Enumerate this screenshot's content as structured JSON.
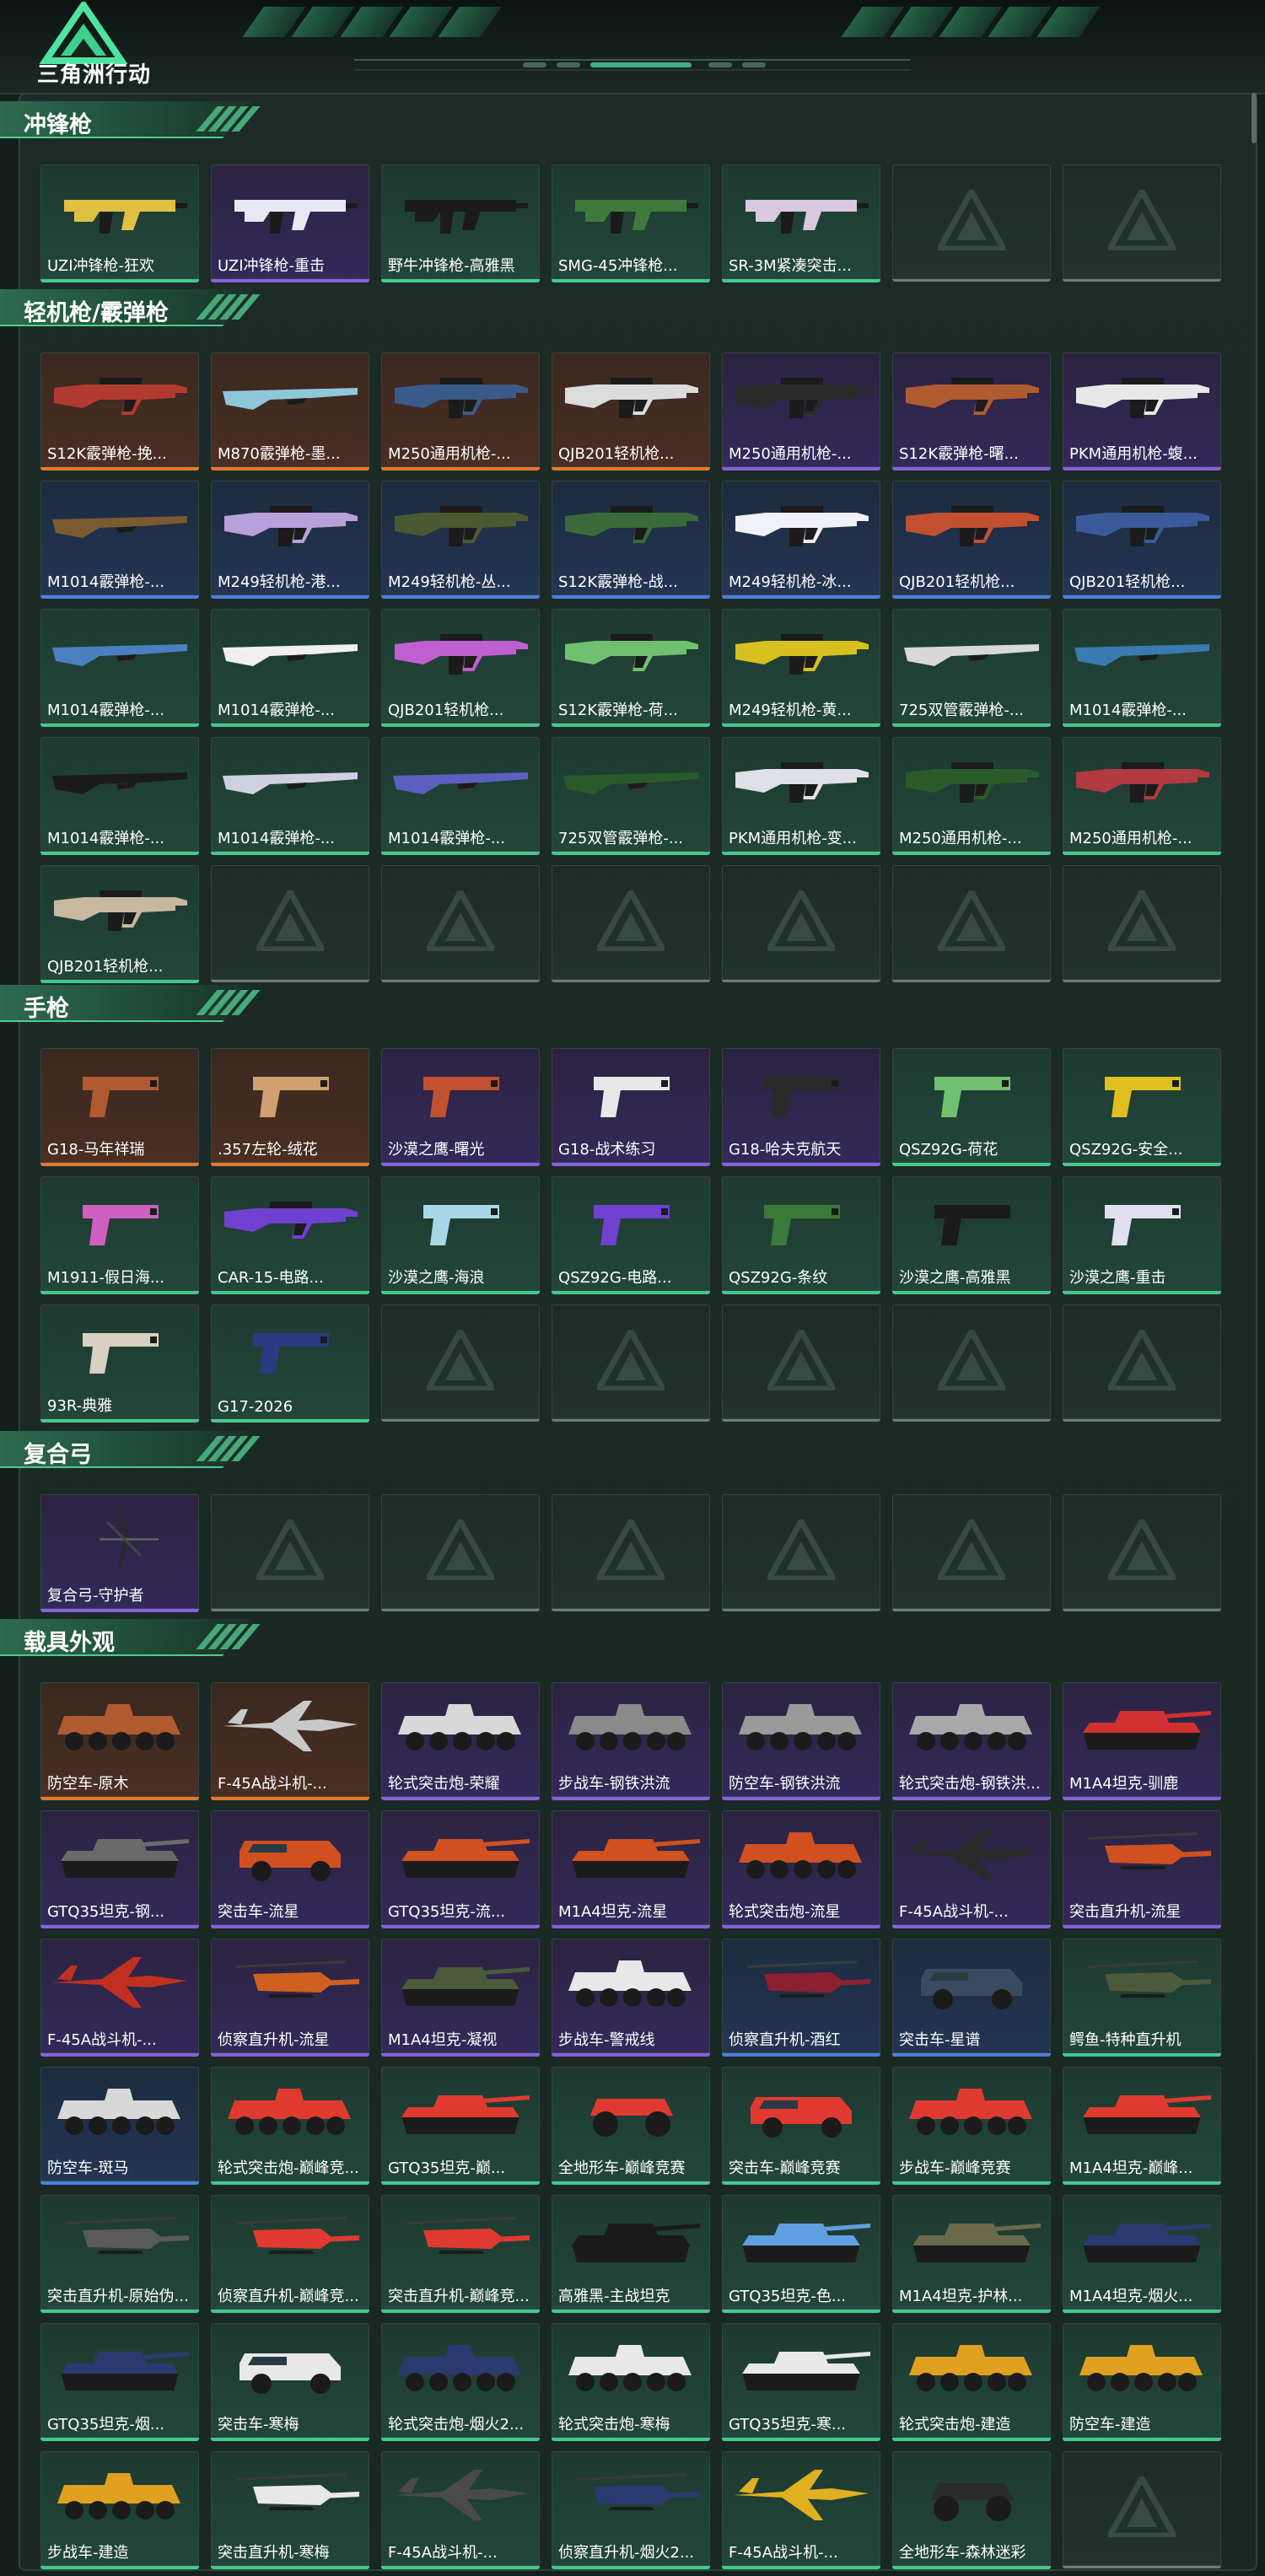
{
  "header": {
    "logo_text": "三角洲行动"
  },
  "colors": {
    "green": "#43c98f",
    "blue": "#4b7fe0",
    "purple": "#8a5ee0",
    "orange": "#e6772f",
    "empty": "#707a76"
  },
  "sections": [
    {
      "title": "冲锋枪",
      "items": [
        {
          "label": "UZI冲锋枪-狂欢",
          "rarity": "green",
          "kind": "smg",
          "c": "#e0c040"
        },
        {
          "label": "UZI冲锋枪-重击",
          "rarity": "purple",
          "kind": "smg",
          "c": "#e8e8f4"
        },
        {
          "label": "野牛冲锋枪-高雅黑",
          "rarity": "green",
          "kind": "smg",
          "c": "#1a1a1a"
        },
        {
          "label": "SMG-45冲锋枪...",
          "rarity": "green",
          "kind": "smg",
          "c": "#3f7a3d"
        },
        {
          "label": "SR-3M紧凑突击...",
          "rarity": "green",
          "kind": "smg",
          "c": "#d8c8e0"
        },
        {
          "label": "",
          "rarity": "empty",
          "kind": "empty"
        },
        {
          "label": "",
          "rarity": "empty",
          "kind": "empty"
        }
      ]
    },
    {
      "title": "轻机枪/霰弹枪",
      "items": [
        {
          "label": "S12K霰弹枪-挽...",
          "rarity": "orange",
          "kind": "rifle",
          "c": "#b03a30"
        },
        {
          "label": "M870霰弹枪-墨...",
          "rarity": "orange",
          "kind": "shotgun",
          "c": "#8ec8d8"
        },
        {
          "label": "M250通用机枪-...",
          "rarity": "orange",
          "kind": "lmg",
          "c": "#3a5a8a"
        },
        {
          "label": "QJB201轻机枪...",
          "rarity": "orange",
          "kind": "lmg",
          "c": "#dcdcdc"
        },
        {
          "label": "M250通用机枪-...",
          "rarity": "purple",
          "kind": "lmg",
          "c": "#2a2a2a"
        },
        {
          "label": "S12K霰弹枪-曙...",
          "rarity": "purple",
          "kind": "rifle",
          "c": "#b05a30"
        },
        {
          "label": "PKM通用机枪-蝮...",
          "rarity": "purple",
          "kind": "lmg",
          "c": "#e8e8e8"
        },
        {
          "label": "M1014霰弹枪-...",
          "rarity": "blue",
          "kind": "shotgun",
          "c": "#7a5a30"
        },
        {
          "label": "M249轻机枪-港...",
          "rarity": "blue",
          "kind": "lmg",
          "c": "#b8a0d8"
        },
        {
          "label": "M249轻机枪-丛...",
          "rarity": "blue",
          "kind": "lmg",
          "c": "#4a5a30"
        },
        {
          "label": "S12K霰弹枪-战...",
          "rarity": "blue",
          "kind": "rifle",
          "c": "#3a6a3a"
        },
        {
          "label": "M249轻机枪-冰...",
          "rarity": "blue",
          "kind": "lmg",
          "c": "#f0f0f8"
        },
        {
          "label": "QJB201轻机枪...",
          "rarity": "blue",
          "kind": "lmg",
          "c": "#c05030"
        },
        {
          "label": "QJB201轻机枪...",
          "rarity": "blue",
          "kind": "lmg",
          "c": "#3a5a9a"
        },
        {
          "label": "M1014霰弹枪-...",
          "rarity": "green",
          "kind": "shotgun",
          "c": "#4a80c0"
        },
        {
          "label": "M1014霰弹枪-...",
          "rarity": "green",
          "kind": "shotgun",
          "c": "#f0f0f0"
        },
        {
          "label": "QJB201轻机枪...",
          "rarity": "green",
          "kind": "lmg",
          "c": "#c060d0"
        },
        {
          "label": "S12K霰弹枪-荷...",
          "rarity": "green",
          "kind": "rifle",
          "c": "#70c070"
        },
        {
          "label": "M249轻机枪-黄...",
          "rarity": "green",
          "kind": "lmg",
          "c": "#d8c020"
        },
        {
          "label": "725双管霰弹枪-...",
          "rarity": "green",
          "kind": "shotgun",
          "c": "#d8d8d8"
        },
        {
          "label": "M1014霰弹枪-...",
          "rarity": "green",
          "kind": "shotgun",
          "c": "#3a7ab0"
        },
        {
          "label": "M1014霰弹枪-...",
          "rarity": "green",
          "kind": "shotgun",
          "c": "#1a1a1a"
        },
        {
          "label": "M1014霰弹枪-...",
          "rarity": "green",
          "kind": "shotgun",
          "c": "#d0d0e0"
        },
        {
          "label": "M1014霰弹枪-...",
          "rarity": "green",
          "kind": "shotgun",
          "c": "#5a60c0"
        },
        {
          "label": "725双管霰弹枪-...",
          "rarity": "green",
          "kind": "shotgun",
          "c": "#2a5a2a"
        },
        {
          "label": "PKM通用机枪-变...",
          "rarity": "green",
          "kind": "lmg",
          "c": "#e0e0e8"
        },
        {
          "label": "M250通用机枪-...",
          "rarity": "green",
          "kind": "lmg",
          "c": "#2a5a2a"
        },
        {
          "label": "M250通用机枪-...",
          "rarity": "green",
          "kind": "lmg",
          "c": "#b03a40"
        },
        {
          "label": "QJB201轻机枪...",
          "rarity": "green",
          "kind": "lmg",
          "c": "#c8b8a0"
        },
        {
          "label": "",
          "rarity": "empty",
          "kind": "empty"
        },
        {
          "label": "",
          "rarity": "empty",
          "kind": "empty"
        },
        {
          "label": "",
          "rarity": "empty",
          "kind": "empty"
        },
        {
          "label": "",
          "rarity": "empty",
          "kind": "empty"
        },
        {
          "label": "",
          "rarity": "empty",
          "kind": "empty"
        },
        {
          "label": "",
          "rarity": "empty",
          "kind": "empty"
        }
      ]
    },
    {
      "title": "手枪",
      "items": [
        {
          "label": "G18-马年祥瑞",
          "rarity": "orange",
          "kind": "pistol",
          "c": "#b05a30"
        },
        {
          "label": ".357左轮-绒花",
          "rarity": "orange",
          "kind": "pistol",
          "c": "#d0a070"
        },
        {
          "label": "沙漠之鹰-曙光",
          "rarity": "purple",
          "kind": "pistol",
          "c": "#c05030"
        },
        {
          "label": "G18-战术练习",
          "rarity": "purple",
          "kind": "pistol",
          "c": "#e8e8e8"
        },
        {
          "label": "G18-哈夫克航天",
          "rarity": "purple",
          "kind": "pistol",
          "c": "#2a2a2a"
        },
        {
          "label": "QSZ92G-荷花",
          "rarity": "green",
          "kind": "pistol",
          "c": "#70c070"
        },
        {
          "label": "QSZ92G-安全...",
          "rarity": "green",
          "kind": "pistol",
          "c": "#e0c020"
        },
        {
          "label": "M1911-假日海...",
          "rarity": "green",
          "kind": "pistol",
          "c": "#d060c0"
        },
        {
          "label": "CAR-15-电路...",
          "rarity": "green",
          "kind": "rifle",
          "c": "#7040d0"
        },
        {
          "label": "沙漠之鹰-海浪",
          "rarity": "green",
          "kind": "pistol",
          "c": "#a8d8e8"
        },
        {
          "label": "QSZ92G-电路...",
          "rarity": "green",
          "kind": "pistol",
          "c": "#7040d0"
        },
        {
          "label": "QSZ92G-条纹",
          "rarity": "green",
          "kind": "pistol",
          "c": "#3a7a3a"
        },
        {
          "label": "沙漠之鹰-高雅黑",
          "rarity": "green",
          "kind": "pistol",
          "c": "#1a1a1a"
        },
        {
          "label": "沙漠之鹰-重击",
          "rarity": "green",
          "kind": "pistol",
          "c": "#e0e0f0"
        },
        {
          "label": "93R-典雅",
          "rarity": "green",
          "kind": "pistol",
          "c": "#d8d0c0"
        },
        {
          "label": "G17-2026",
          "rarity": "green",
          "kind": "pistol",
          "c": "#2a3a80"
        },
        {
          "label": "",
          "rarity": "empty",
          "kind": "empty"
        },
        {
          "label": "",
          "rarity": "empty",
          "kind": "empty"
        },
        {
          "label": "",
          "rarity": "empty",
          "kind": "empty"
        },
        {
          "label": "",
          "rarity": "empty",
          "kind": "empty"
        },
        {
          "label": "",
          "rarity": "empty",
          "kind": "empty"
        }
      ]
    },
    {
      "title": "复合弓",
      "items": [
        {
          "label": "复合弓-守护者",
          "rarity": "purple",
          "kind": "bow",
          "c": "#2a2a2a"
        },
        {
          "label": "",
          "rarity": "empty",
          "kind": "empty"
        },
        {
          "label": "",
          "rarity": "empty",
          "kind": "empty"
        },
        {
          "label": "",
          "rarity": "empty",
          "kind": "empty"
        },
        {
          "label": "",
          "rarity": "empty",
          "kind": "empty"
        },
        {
          "label": "",
          "rarity": "empty",
          "kind": "empty"
        },
        {
          "label": "",
          "rarity": "empty",
          "kind": "empty"
        }
      ]
    },
    {
      "title": "载具外观",
      "items": [
        {
          "label": "防空车-原木",
          "rarity": "orange",
          "kind": "apc",
          "c": "#b05a30"
        },
        {
          "label": "F-45A战斗机-...",
          "rarity": "orange",
          "kind": "jet",
          "c": "#c8c8c8"
        },
        {
          "label": "轮式突击炮-荣耀",
          "rarity": "purple",
          "kind": "apc",
          "c": "#d8d8d8"
        },
        {
          "label": "步战车-钢铁洪流",
          "rarity": "purple",
          "kind": "apc",
          "c": "#8a8a8a"
        },
        {
          "label": "防空车-钢铁洪流",
          "rarity": "purple",
          "kind": "apc",
          "c": "#9a9a9a"
        },
        {
          "label": "轮式突击炮-钢铁洪...",
          "rarity": "purple",
          "kind": "apc",
          "c": "#a8a8a8"
        },
        {
          "label": "M1A4坦克-驯鹿",
          "rarity": "purple",
          "kind": "tank",
          "c": "#d03030"
        },
        {
          "label": "GTQ35坦克-钢...",
          "rarity": "purple",
          "kind": "tank",
          "c": "#6a6a6a"
        },
        {
          "label": "突击车-流星",
          "rarity": "purple",
          "kind": "truck",
          "c": "#d05020"
        },
        {
          "label": "GTQ35坦克-流...",
          "rarity": "purple",
          "kind": "tank",
          "c": "#d05020"
        },
        {
          "label": "M1A4坦克-流星",
          "rarity": "purple",
          "kind": "tank",
          "c": "#d05020"
        },
        {
          "label": "轮式突击炮-流星",
          "rarity": "purple",
          "kind": "apc",
          "c": "#d05020"
        },
        {
          "label": "F-45A战斗机-...",
          "rarity": "purple",
          "kind": "jet",
          "c": "#2a2a2a"
        },
        {
          "label": "突击直升机-流星",
          "rarity": "purple",
          "kind": "heli",
          "c": "#d05020"
        },
        {
          "label": "F-45A战斗机-...",
          "rarity": "purple",
          "kind": "jet",
          "c": "#c03020"
        },
        {
          "label": "侦察直升机-流星",
          "rarity": "purple",
          "kind": "heli",
          "c": "#d06020"
        },
        {
          "label": "M1A4坦克-凝视",
          "rarity": "purple",
          "kind": "tank",
          "c": "#4a5a3a"
        },
        {
          "label": "步战车-警戒线",
          "rarity": "purple",
          "kind": "apc",
          "c": "#e8e8e8"
        },
        {
          "label": "侦察直升机-酒红",
          "rarity": "blue",
          "kind": "heli",
          "c": "#8a2030"
        },
        {
          "label": "突击车-星谱",
          "rarity": "blue",
          "kind": "truck",
          "c": "#3a4a60"
        },
        {
          "label": "鳄鱼-特种直升机",
          "rarity": "green",
          "kind": "heli",
          "c": "#4a5a3a"
        },
        {
          "label": "防空车-斑马",
          "rarity": "blue",
          "kind": "apc",
          "c": "#d8d8d8"
        },
        {
          "label": "轮式突击炮-巅峰竞...",
          "rarity": "green",
          "kind": "apc",
          "c": "#e03a30"
        },
        {
          "label": "GTQ35坦克-巅...",
          "rarity": "green",
          "kind": "tank",
          "c": "#e03a30"
        },
        {
          "label": "全地形车-巅峰竞赛",
          "rarity": "green",
          "kind": "atv",
          "c": "#e03a30"
        },
        {
          "label": "突击车-巅峰竞赛",
          "rarity": "green",
          "kind": "truck",
          "c": "#e03a30"
        },
        {
          "label": "步战车-巅峰竞赛",
          "rarity": "green",
          "kind": "apc",
          "c": "#e03a30"
        },
        {
          "label": "M1A4坦克-巅峰...",
          "rarity": "green",
          "kind": "tank",
          "c": "#e03a30"
        },
        {
          "label": "突击直升机-原始伪...",
          "rarity": "green",
          "kind": "heli",
          "c": "#5a5a5a"
        },
        {
          "label": "侦察直升机-巅峰竞...",
          "rarity": "green",
          "kind": "heli",
          "c": "#e03a30"
        },
        {
          "label": "突击直升机-巅峰竞...",
          "rarity": "green",
          "kind": "heli",
          "c": "#e03a30"
        },
        {
          "label": "高雅黑-主战坦克",
          "rarity": "green",
          "kind": "tank",
          "c": "#1a1a1a"
        },
        {
          "label": "GTQ35坦克-色...",
          "rarity": "green",
          "kind": "tank",
          "c": "#60a0e0"
        },
        {
          "label": "M1A4坦克-护林...",
          "rarity": "green",
          "kind": "tank",
          "c": "#6a6a4a"
        },
        {
          "label": "M1A4坦克-烟火...",
          "rarity": "green",
          "kind": "tank",
          "c": "#2a3a70"
        },
        {
          "label": "GTQ35坦克-烟...",
          "rarity": "green",
          "kind": "tank",
          "c": "#2a3a70"
        },
        {
          "label": "突击车-寒梅",
          "rarity": "green",
          "kind": "truck",
          "c": "#e8e8e8"
        },
        {
          "label": "轮式突击炮-烟火2...",
          "rarity": "green",
          "kind": "apc",
          "c": "#2a3a70"
        },
        {
          "label": "轮式突击炮-寒梅",
          "rarity": "green",
          "kind": "apc",
          "c": "#e8e8e8"
        },
        {
          "label": "GTQ35坦克-寒...",
          "rarity": "green",
          "kind": "tank",
          "c": "#e8e8e8"
        },
        {
          "label": "轮式突击炮-建造",
          "rarity": "green",
          "kind": "apc",
          "c": "#e0a020"
        },
        {
          "label": "防空车-建造",
          "rarity": "green",
          "kind": "apc",
          "c": "#e0a020"
        },
        {
          "label": "步战车-建造",
          "rarity": "green",
          "kind": "apc",
          "c": "#e0a020"
        },
        {
          "label": "突击直升机-寒梅",
          "rarity": "green",
          "kind": "heli",
          "c": "#e8e8e8"
        },
        {
          "label": "F-45A战斗机-...",
          "rarity": "green",
          "kind": "jet",
          "c": "#4a4a4a"
        },
        {
          "label": "侦察直升机-烟火2...",
          "rarity": "green",
          "kind": "heli",
          "c": "#2a3a70"
        },
        {
          "label": "F-45A战斗机-...",
          "rarity": "green",
          "kind": "jet",
          "c": "#e0b020"
        },
        {
          "label": "全地形车-森林迷彩",
          "rarity": "green",
          "kind": "atv",
          "c": "#2a2a2a"
        },
        {
          "label": "",
          "rarity": "empty",
          "kind": "empty"
        }
      ]
    }
  ]
}
